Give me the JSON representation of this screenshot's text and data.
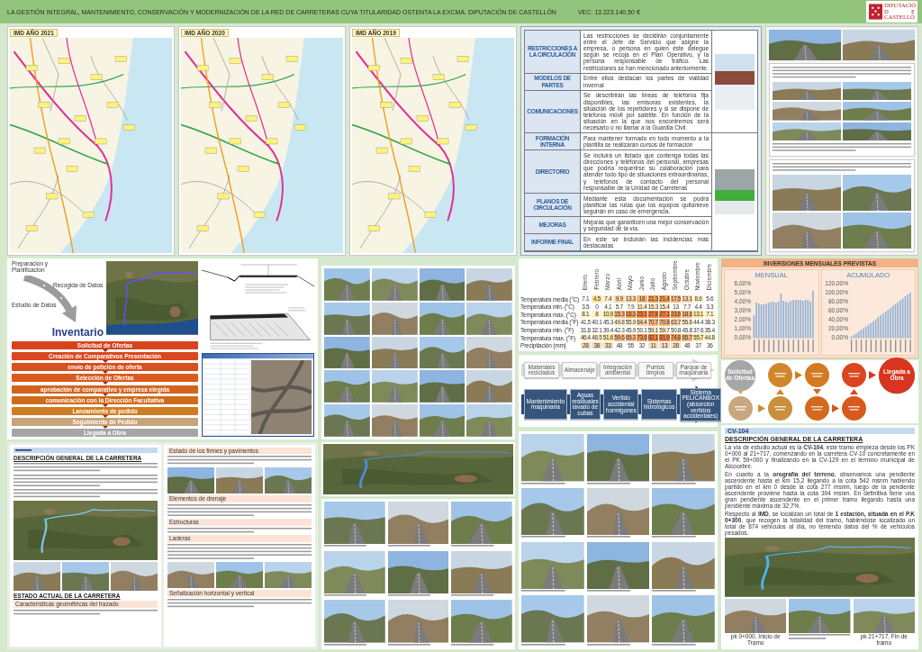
{
  "header": {
    "title": "LA GESTIÓN INTEGRAL, MANTENIMIENTO, CONSERVACIÓN Y MODERNIZACIÓN DE LA RED DE CARRETERAS CUYA TITULARIDAD OSTENTA LA EXCMA. DIPUTACIÓN DE CASTELLÓN",
    "budget": "VEC: 13.223.140,50 €",
    "logo_text": [
      "DIPUTACIÓ",
      "D E",
      "CASTELLÓ"
    ]
  },
  "imd_maps": [
    {
      "title": "IMD AÑO 2021"
    },
    {
      "title": "IMD AÑO 2020"
    },
    {
      "title": "IMD AÑO 2019"
    }
  ],
  "winter_plan": [
    {
      "label": "RESTRICCIONES A LA CIRCULACIÓN",
      "text": "Las restricciones se decidirán conjuntamente entre el Jefe de Servicio que asigne la empresa, o persona en quien éste delegue según se recoja en el Plan Operativo, y la persona responsable de tráfico. Las restricciones se han mencionado anteriormente."
    },
    {
      "label": "MODELOS DE PARTES",
      "text": "Entre ellos destacan los partes de vialidad invernal"
    },
    {
      "label": "COMUNICACIONES",
      "text": "Se describirán las líneas de telefonía fija disponibles, las emisoras existentes, la situación de los repetidores y si se dispone de telefonía móvil por satélite. En función de la situación en la que nos encontremos será necesario o no llamar a la Guardia Civil."
    },
    {
      "label": "FORMACIÓN INTERNA",
      "text": "Para mantener formado en todo momento a la plantilla se realizarán cursos de formación"
    },
    {
      "label": "DIRECTORIO",
      "text": "Se incluirá un listado que contenga todas las direcciones y teléfonos del personal, empresas que podría requerirse su colaboración para atender todo tipo de situaciones extraordinarias, y teléfonos de contacto del personal responsable de la Unidad de Carreteras"
    },
    {
      "label": "PLANOS DE CIRCULACIÓN",
      "text": "Mediante esta documentación se podrá planificar las rutas que los equipos quitanieve seguirán en caso de emergencia."
    },
    {
      "label": "MEJORAS",
      "text": "Mejoras que garanticen una mejor conservación y seguridad de la vía."
    },
    {
      "label": "INFORME FINAL",
      "text": "En este se incluirán las incidencias más destacadas"
    }
  ],
  "inventory": {
    "steps": [
      "Preparacion y Planificacion",
      "Recogida de Datos",
      "Estudio de Datos"
    ],
    "result": "Inventario"
  },
  "purchase_steps": [
    {
      "label": "Solicitud de Ofertas",
      "color": "#d8431e"
    },
    {
      "label": "Creación de Comparativos Presentación",
      "color": "#d8471e"
    },
    {
      "label": "envío de petición de oferta",
      "color": "#d94f1f"
    },
    {
      "label": "Selección de Ofertas",
      "color": "#db5a20"
    },
    {
      "label": "aprobación de comparativo y empresa elegida",
      "color": "#d4641d"
    },
    {
      "label": "comunicación con la Dirección Facultativa",
      "color": "#cf6c1c"
    },
    {
      "label": "Lanzamiento de pedido",
      "color": "#cf7d22"
    },
    {
      "label": "Seguimiento de Pedido",
      "color": "#c8a27a"
    },
    {
      "label": "Llegada a Obra",
      "color": "#a6a6a6"
    }
  ],
  "climate_table": {
    "columns": [
      "Enero",
      "Febrero",
      "Marzo",
      "Abril",
      "Mayo",
      "Junio",
      "Julio",
      "Agosto",
      "Septiembre",
      "Octubre",
      "Noviembre",
      "Diciembre"
    ],
    "rows": [
      {
        "label": "Temperatura media (°C)",
        "cells": [
          {
            "value": "7.1",
            "color": "#ffffff"
          },
          {
            "value": "4.5",
            "color": "#ffe699"
          },
          {
            "value": "7.4",
            "color": "#fff2cc"
          },
          {
            "value": "9.9",
            "color": "#fcd5a8"
          },
          {
            "value": "13.3",
            "color": "#fcd5a8"
          },
          {
            "value": "18",
            "color": "#f9b67a"
          },
          {
            "value": "21.3",
            "color": "#f59a50"
          },
          {
            "value": "21.4",
            "color": "#f59a50"
          },
          {
            "value": "17.5",
            "color": "#f9b67a"
          },
          {
            "value": "13.1",
            "color": "#fcd5a8"
          },
          {
            "value": "8.6",
            "color": "#fff2cc"
          },
          {
            "value": "5.6",
            "color": "#ffffff"
          }
        ]
      },
      {
        "label": "Temperatura min. (°C)",
        "cells": [
          {
            "value": "3.5",
            "color": "#ffffff"
          },
          {
            "value": "0",
            "color": "#ffffff"
          },
          {
            "value": "4.1",
            "color": "#ffffff"
          },
          {
            "value": "5.7",
            "color": "#ffffff"
          },
          {
            "value": "7.9",
            "color": "#ffffff"
          },
          {
            "value": "11.4",
            "color": "#fff2cc"
          },
          {
            "value": "15.3",
            "color": "#fff2cc"
          },
          {
            "value": "15.4",
            "color": "#fff2cc"
          },
          {
            "value": "13",
            "color": "#ffffff"
          },
          {
            "value": "7.7",
            "color": "#ffffff"
          },
          {
            "value": "4.4",
            "color": "#ffffff"
          },
          {
            "value": "3.3",
            "color": "#ffffff"
          }
        ]
      },
      {
        "label": "Temperatura max. (°C)",
        "cells": [
          {
            "value": "8.1",
            "color": "#fff2cc"
          },
          {
            "value": "8",
            "color": "#fff2cc"
          },
          {
            "value": "10.9",
            "color": "#ffe699"
          },
          {
            "value": "15.3",
            "color": "#f9b67a"
          },
          {
            "value": "18.3",
            "color": "#f59a50"
          },
          {
            "value": "23.1",
            "color": "#f47f3a"
          },
          {
            "value": "27.8",
            "color": "#f47f3a"
          },
          {
            "value": "27.1",
            "color": "#f47f3a"
          },
          {
            "value": "23.6",
            "color": "#f59a50"
          },
          {
            "value": "18.6",
            "color": "#f9b67a"
          },
          {
            "value": "13.1",
            "color": "#ffe699"
          },
          {
            "value": "7.1",
            "color": "#fff2cc"
          }
        ]
      },
      {
        "label": "Temperatura media (°F)",
        "cells": [
          {
            "value": "41.5",
            "color": "#ffffff"
          },
          {
            "value": "40.1",
            "color": "#ffffff"
          },
          {
            "value": "45.3",
            "color": "#ffffff"
          },
          {
            "value": "49.8",
            "color": "#fff2cc"
          },
          {
            "value": "55.9",
            "color": "#fff2cc"
          },
          {
            "value": "64.4",
            "color": "#fcd5a8"
          },
          {
            "value": "70.7",
            "color": "#f9b67a"
          },
          {
            "value": "70.8",
            "color": "#f9b67a"
          },
          {
            "value": "63.7",
            "color": "#fcd5a8"
          },
          {
            "value": "55.6",
            "color": "#fff2cc"
          },
          {
            "value": "44.4",
            "color": "#ffffff"
          },
          {
            "value": "38.3",
            "color": "#ffffff"
          }
        ]
      },
      {
        "label": "Temperatura min. (°F)",
        "cells": [
          {
            "value": "31.8",
            "color": "#ffffff"
          },
          {
            "value": "32.1",
            "color": "#ffffff"
          },
          {
            "value": "39.4",
            "color": "#ffffff"
          },
          {
            "value": "42.3",
            "color": "#ffffff"
          },
          {
            "value": "45.9",
            "color": "#ffffff"
          },
          {
            "value": "50.1",
            "color": "#ffffff"
          },
          {
            "value": "59.1",
            "color": "#fff2cc"
          },
          {
            "value": "59.7",
            "color": "#fff2cc"
          },
          {
            "value": "50.8",
            "color": "#ffffff"
          },
          {
            "value": "45.8",
            "color": "#ffffff"
          },
          {
            "value": "37.6",
            "color": "#ffffff"
          },
          {
            "value": "35.4",
            "color": "#ffffff"
          }
        ]
      },
      {
        "label": "Temperatura max. (°F)",
        "cells": [
          {
            "value": "46.4",
            "color": "#fff2cc"
          },
          {
            "value": "46.5",
            "color": "#fff2cc"
          },
          {
            "value": "51.6",
            "color": "#ffe699"
          },
          {
            "value": "59.6",
            "color": "#f9b67a"
          },
          {
            "value": "65.3",
            "color": "#f9b67a"
          },
          {
            "value": "73.6",
            "color": "#f59a50"
          },
          {
            "value": "82.1",
            "color": "#f47f3a"
          },
          {
            "value": "81.9",
            "color": "#f47f3a"
          },
          {
            "value": "74.8",
            "color": "#f59a50"
          },
          {
            "value": "65.7",
            "color": "#f9b67a"
          },
          {
            "value": "55.7",
            "color": "#ffe699"
          },
          {
            "value": "44.8",
            "color": "#fff2cc"
          }
        ]
      },
      {
        "label": "Precipitación (mm)",
        "cells": [
          {
            "value": "28",
            "color": "#f6dcc0"
          },
          {
            "value": "38",
            "color": "#f6dcc0"
          },
          {
            "value": "33",
            "color": "#f6dcc0"
          },
          {
            "value": "48",
            "color": "#ffffff"
          },
          {
            "value": "55",
            "color": "#ffffff"
          },
          {
            "value": "32",
            "color": "#ffffff"
          },
          {
            "value": "11",
            "color": "#f6dcc0"
          },
          {
            "value": "13",
            "color": "#f6dcc0"
          },
          {
            "value": "28",
            "color": "#f6dcc0"
          },
          {
            "value": "48",
            "color": "#ffffff"
          },
          {
            "value": "37",
            "color": "#ffffff"
          },
          {
            "value": "36",
            "color": "#ffffff"
          }
        ]
      }
    ]
  },
  "environment": [
    {
      "kind": "light",
      "items": [
        "Materiales reciclados",
        "Almacenaje",
        "Integración ambiental",
        "Puntos limpios",
        "Parque de maquinaria"
      ]
    },
    {
      "kind": "dark",
      "items": [
        "Mantenimiento maquinaria",
        "Aguas residuales lavado de cubas",
        "Vertido accidental hormigones",
        "Sistemas hidrológicos",
        "Sistema PELICANBOX (absorción vertidos accidentales)"
      ]
    }
  ],
  "investment": {
    "title": "INVERSIONES MENSUALES PREVISTAS",
    "charts": [
      {
        "title": "MENSUAL",
        "chart_data": {
          "type": "bar",
          "series": [
            {
              "color": "#95b3d7",
              "values": [
                2.5,
                3.9,
                3.8,
                3.7,
                3.7,
                3.8,
                3.9,
                4.0,
                4.0,
                3.9,
                4.0,
                4.9,
                4.1,
                4.0,
                3.9,
                4.1,
                4.2,
                4.2,
                4.2,
                4.2,
                4.1,
                4.2,
                4.2,
                4.0,
                5.2
              ]
            }
          ],
          "ylim": [
            0,
            6
          ],
          "yticks": [
            {
              "value": 0,
              "label": "0,00%"
            },
            {
              "value": 1,
              "label": "1,00%"
            },
            {
              "value": 2,
              "label": "2,00%"
            },
            {
              "value": 3,
              "label": "3,00%"
            },
            {
              "value": 4,
              "label": "4,00%"
            },
            {
              "value": 5,
              "label": "5,00%"
            },
            {
              "value": 6,
              "label": "6,00%"
            }
          ]
        }
      },
      {
        "title": "ACUMULADO",
        "chart_data": {
          "type": "bar",
          "series": [
            {
              "color": "#95b3d7",
              "values": [
                3,
                6,
                10,
                14,
                18,
                21,
                25,
                29,
                33,
                37,
                41,
                46,
                50,
                54,
                58,
                62,
                66,
                71,
                75,
                79,
                83,
                87,
                92,
                96,
                100
              ]
            }
          ],
          "ylim": [
            0,
            120
          ],
          "yticks": [
            {
              "value": 0,
              "label": "0,00%"
            },
            {
              "value": 20,
              "label": "20,00%"
            },
            {
              "value": 40,
              "label": "40,00%"
            },
            {
              "value": 60,
              "label": "60,00%"
            },
            {
              "value": 80,
              "label": "80,00%"
            },
            {
              "value": 100,
              "label": "100,00%"
            },
            {
              "value": 120,
              "label": "120,00%"
            }
          ]
        }
      }
    ]
  },
  "order_flow": {
    "start": "Solicitud de Ofertas",
    "end": "Llegada a Obra"
  },
  "road_report": {
    "pages": [
      [
        {
          "kind": "road_tag"
        },
        {
          "kind": "heading",
          "text": "DESCRIPCIÓN GENERAL DE LA CARRETERA"
        },
        {
          "kind": "text_block"
        },
        {
          "kind": "text_block"
        },
        {
          "kind": "text_block"
        },
        {
          "kind": "map"
        },
        {
          "kind": "photos"
        },
        {
          "kind": "heading",
          "text": "ESTADO ACTUAL DE LA CARRETERA"
        },
        {
          "kind": "subheading",
          "text": "Características geométricas del trazado"
        },
        {
          "kind": "text_block"
        }
      ],
      [
        {
          "kind": "subheading",
          "text": "Estado de los firmes y pavimentos"
        },
        {
          "kind": "text_block"
        },
        {
          "kind": "photos"
        },
        {
          "kind": "subheading",
          "text": "Elementos de drenaje"
        },
        {
          "kind": "text_block"
        },
        {
          "kind": "subheading",
          "text": "Estructuras"
        },
        {
          "kind": "text_block"
        },
        {
          "kind": "subheading",
          "text": "Laderas"
        },
        {
          "kind": "text_block"
        },
        {
          "kind": "photos"
        },
        {
          "kind": "subheading",
          "text": "Señalización horizontal y vertical"
        },
        {
          "kind": "text_block"
        }
      ]
    ]
  },
  "cv104": {
    "road": "CV-104",
    "heading": "DESCRIPCIÓN GENERAL DE LA CARRETERA",
    "paragraphs": [
      "La vía de estudio actual es la **CV-104**, este tramo empieza desde los PK 0+000 al 21+717, comenzando en la carretera CV-10 concretamente en el PK 59+000 y finalizando en la CV-129 en el término municipal de Alcocebre.",
      "En cuanto a la **orografía del terreno**, observamos una pendiente ascendente hasta el km 15,2 llegando a la cota 542 msnm habiendo partido en el km 0 desde la cota 277 msnm, luego de la pendiente ascendente proviene hasta la cota 394 msnm. En definitiva tiene una gran pendiente ascendente en el primer tramo llegando hasta una pendiente máxima de 32,7%.",
      "Respecto al **IMD**, se localizan un total de **1 estación, situada en el P.K 0+300**, que recogen la totalidad del tramo, habiéndose localizado un total de 874 vehículos al día, no teniendo datos del % de vehículos pesados."
    ],
    "photos": [
      {
        "kind": "captioned",
        "caption": "pk 0+000. Inicio de Tramo"
      },
      {
        "kind": "unreadable"
      },
      {
        "kind": "captioned",
        "caption": "pk 21+717. Fin de tramo"
      }
    ]
  }
}
